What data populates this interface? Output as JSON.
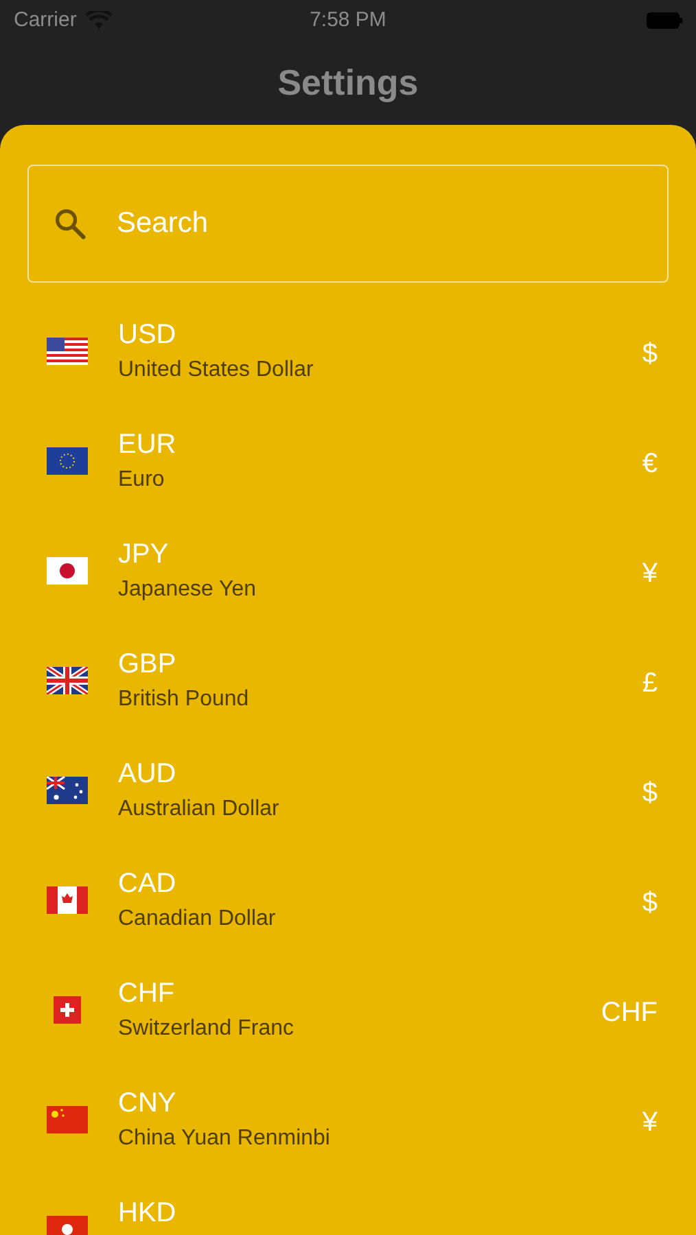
{
  "status_bar": {
    "carrier": "Carrier",
    "time": "7:58 PM"
  },
  "header": {
    "title": "Settings"
  },
  "search": {
    "placeholder": "Search"
  },
  "currencies": [
    {
      "kind": "us",
      "code": "USD",
      "name": "United States Dollar",
      "symbol": "$"
    },
    {
      "kind": "eu",
      "code": "EUR",
      "name": "Euro",
      "symbol": "€"
    },
    {
      "kind": "jp",
      "code": "JPY",
      "name": "Japanese Yen",
      "symbol": "¥"
    },
    {
      "kind": "gb",
      "code": "GBP",
      "name": "British Pound",
      "symbol": "£"
    },
    {
      "kind": "au",
      "code": "AUD",
      "name": "Australian Dollar",
      "symbol": "$"
    },
    {
      "kind": "ca",
      "code": "CAD",
      "name": "Canadian Dollar",
      "symbol": "$"
    },
    {
      "kind": "ch",
      "code": "CHF",
      "name": "Switzerland Franc",
      "symbol": "CHF"
    },
    {
      "kind": "cn",
      "code": "CNY",
      "name": "China Yuan Renminbi",
      "symbol": "¥"
    },
    {
      "kind": "hk",
      "code": "HKD"
    }
  ]
}
